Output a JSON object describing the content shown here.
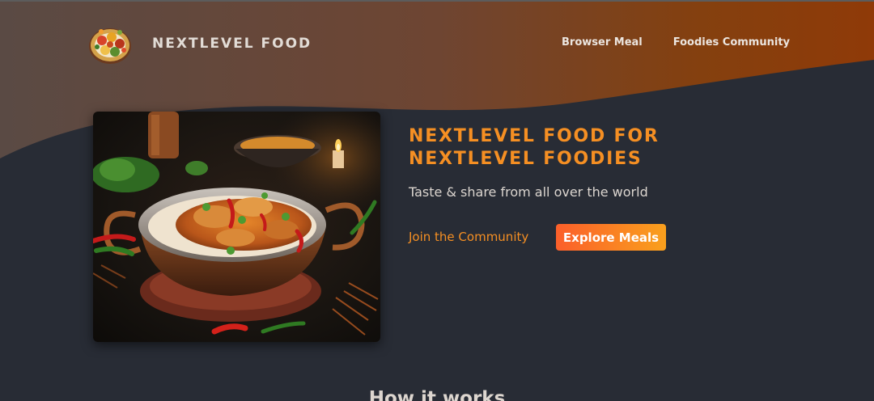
{
  "header": {
    "logo_alt": "A plate with food on it",
    "logo_text": "NEXTLEVEL FOOD",
    "nav": {
      "browse_meals": "Browser Meal",
      "community": "Foodies Community"
    }
  },
  "hero": {
    "image_alt": "A bowl of chicken curry with rice",
    "title": "NEXTLEVEL FOOD FOR NEXTLEVEL FOODIES",
    "subtitle": "Taste & share from all over the world",
    "community_link": "Join the Community",
    "explore_button": "Explore Meals"
  },
  "main": {
    "section_heading": "How it works"
  },
  "colors": {
    "background": "#282c35",
    "accent_orange": "#f58f23",
    "button_gradient_start": "#fb5f2a",
    "button_gradient_end": "#f9a01d",
    "header_gradient_start": "#5a4a42",
    "header_gradient_end": "#8f3a0a"
  },
  "icons": {
    "logo": "food-plate-logo-icon"
  }
}
